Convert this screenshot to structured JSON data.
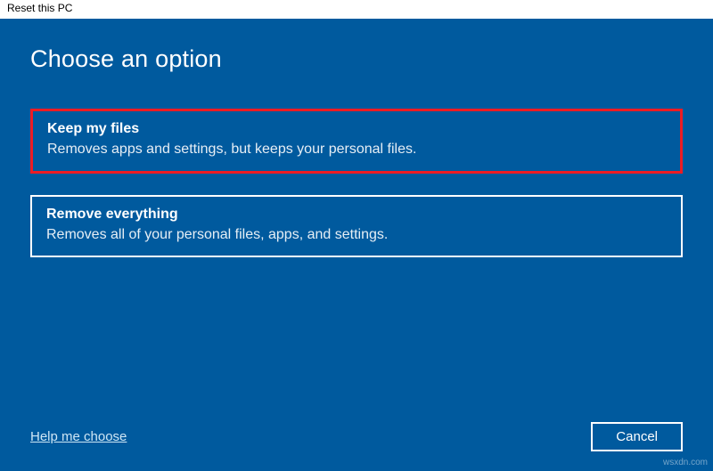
{
  "titlebar": {
    "title": "Reset this PC"
  },
  "heading": "Choose an option",
  "options": [
    {
      "title": "Keep my files",
      "desc": "Removes apps and settings, but keeps your personal files.",
      "highlighted": true
    },
    {
      "title": "Remove everything",
      "desc": "Removes all of your personal files, apps, and settings.",
      "highlighted": false
    }
  ],
  "footer": {
    "help_label": "Help me choose",
    "cancel_label": "Cancel"
  },
  "watermark": "wsxdn.com"
}
